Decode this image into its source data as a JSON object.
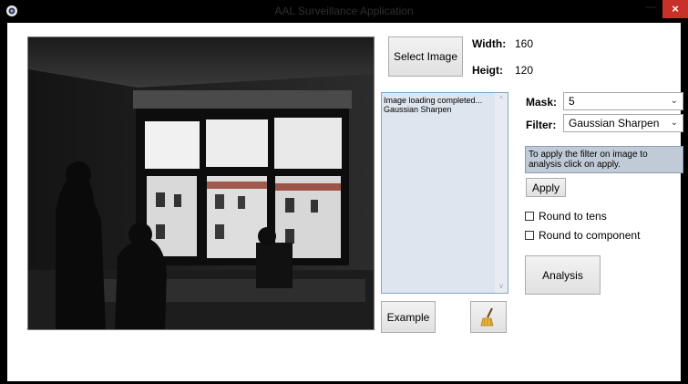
{
  "window": {
    "title": "AAL Surveillance Application",
    "minimize_glyph": "—",
    "close_glyph": "×"
  },
  "buttons": {
    "select_image": "Select Image",
    "example": "Example",
    "apply": "Apply",
    "analysis": "Analysis"
  },
  "info": {
    "width_label": "Width:",
    "width_value": "160",
    "height_label": "Heigt:",
    "height_value": "120"
  },
  "log": {
    "lines": [
      "Image loading completed...",
      "Gaussian Sharpen"
    ]
  },
  "mask": {
    "label": "Mask:",
    "value": "5"
  },
  "filter": {
    "label": "Filter:",
    "value": "Gaussian Sharpen"
  },
  "hint": "To apply the filter on image to analysis click on apply.",
  "checkboxes": {
    "round_tens": {
      "label": "Round to tens",
      "checked": false
    },
    "round_component": {
      "label": "Round to component",
      "checked": false
    }
  },
  "icons": {
    "app": "app-icon",
    "broom": "broom-icon",
    "dropdown": "chevron-down-icon"
  }
}
